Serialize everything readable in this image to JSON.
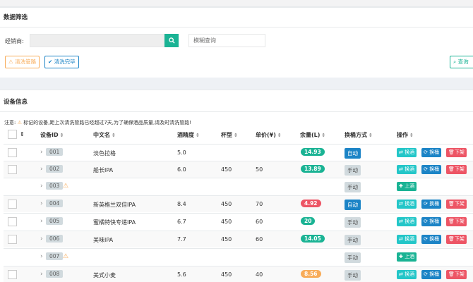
{
  "filter": {
    "title": "数据筛选",
    "dealer_label": "经销商:",
    "dealer_value": "",
    "fuzzy_placeholder": "模糊查询",
    "clean_pipe_label": "清洗管路",
    "clean_done_label": "清洗完毕",
    "query_label": "查询"
  },
  "devices": {
    "title": "设备信息",
    "note_prefix": "注意:",
    "note_text": "标记的设备,距上次清洗管路已经超过7天,为了确保酒品质量,请及时清洗管路!",
    "columns": {
      "id": "设备ID",
      "name": "中文名",
      "abv": "酒精度",
      "cup": "杯型",
      "price": "单价(¥)",
      "remain": "余量(L)",
      "mode": "换桶方式",
      "ops": "操作"
    },
    "actions": {
      "swap_wine": "换酒",
      "swap_barrel": "换桶",
      "off_shelf": "下架",
      "on_shelf": "上酒"
    },
    "rows": [
      {
        "id": "001",
        "name": "淡色拉格",
        "abv": "5.0",
        "cup": "",
        "price": "",
        "remain": "14.93",
        "remain_color": "green",
        "mode": "自动",
        "mode_type": "auto",
        "warn": false
      },
      {
        "id": "002",
        "name": "船长IPA",
        "abv": "6.0",
        "cup": "450",
        "price": "50",
        "remain": "13.89",
        "remain_color": "green",
        "mode": "手动",
        "mode_type": "manual",
        "warn": false
      },
      {
        "id": "003",
        "name": "",
        "abv": "",
        "cup": "",
        "price": "",
        "remain": "",
        "remain_color": "",
        "mode": "手动",
        "mode_type": "manual",
        "warn": true
      },
      {
        "id": "004",
        "name": "新英格兰双倍IPA",
        "abv": "8.4",
        "cup": "450",
        "price": "70",
        "remain": "4.92",
        "remain_color": "red",
        "mode": "自动",
        "mode_type": "auto",
        "warn": false
      },
      {
        "id": "005",
        "name": "蜜橘特快专递IPA",
        "abv": "6.7",
        "cup": "450",
        "price": "60",
        "remain": "20",
        "remain_color": "green",
        "mode": "手动",
        "mode_type": "manual",
        "warn": false
      },
      {
        "id": "006",
        "name": "美味IPA",
        "abv": "7.7",
        "cup": "450",
        "price": "60",
        "remain": "14.05",
        "remain_color": "green",
        "mode": "手动",
        "mode_type": "manual",
        "warn": false
      },
      {
        "id": "007",
        "name": "",
        "abv": "",
        "cup": "",
        "price": "",
        "remain": "",
        "remain_color": "",
        "mode": "手动",
        "mode_type": "manual",
        "warn": true
      },
      {
        "id": "008",
        "name": "美式小麦",
        "abv": "5.6",
        "cup": "450",
        "price": "40",
        "remain": "8.56",
        "remain_color": "orange",
        "mode": "手动",
        "mode_type": "manual",
        "warn": false
      }
    ]
  },
  "colors": {
    "primary": "#1ab394",
    "info": "#1c84c6",
    "danger": "#ed5565",
    "warning": "#f8ac59",
    "cyan": "#23c6c8"
  }
}
